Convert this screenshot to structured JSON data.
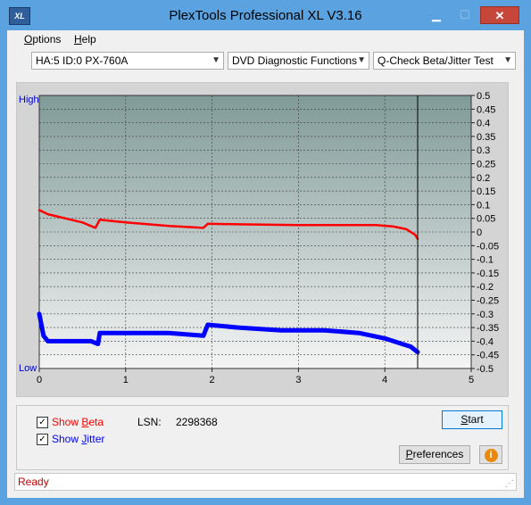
{
  "window": {
    "title": "PlexTools Professional XL V3.16",
    "icon_text": "XL"
  },
  "menu": {
    "items": [
      {
        "label": "Options",
        "ul": "O",
        "rest": "ptions"
      },
      {
        "label": "Help",
        "ul": "H",
        "rest": "elp"
      }
    ]
  },
  "toolbar": {
    "drive": "HA:5 ID:0  PX-760A",
    "function": "DVD Diagnostic Functions",
    "test": "Q-Check Beta/Jitter Test"
  },
  "chart_data": {
    "type": "line",
    "x_ticks": [
      "0",
      "1",
      "2",
      "3",
      "4",
      "5"
    ],
    "xlim": [
      0,
      5
    ],
    "y_ticks": [
      "0.5",
      "0.45",
      "0.4",
      "0.35",
      "0.3",
      "0.25",
      "0.2",
      "0.15",
      "0.1",
      "0.05",
      "0",
      "-0.05",
      "-0.1",
      "-0.15",
      "-0.2",
      "-0.25",
      "-0.3",
      "-0.35",
      "-0.4",
      "-0.45",
      "-0.5"
    ],
    "ylim": [
      -0.5,
      0.5
    ],
    "left_labels": {
      "high": "High",
      "low": "Low"
    },
    "grid": true,
    "marker_x": 4.38,
    "series": [
      {
        "color": "#ff0000",
        "x": [
          0,
          0.1,
          0.3,
          0.5,
          0.65,
          0.7,
          1.0,
          1.5,
          1.9,
          1.95,
          2.3,
          3.0,
          3.5,
          3.9,
          4.1,
          4.25,
          4.35,
          4.38
        ],
        "y": [
          0.08,
          0.065,
          0.05,
          0.035,
          0.015,
          0.045,
          0.035,
          0.022,
          0.015,
          0.03,
          0.028,
          0.025,
          0.025,
          0.025,
          0.02,
          0.01,
          -0.01,
          -0.025
        ]
      },
      {
        "color": "#0000ff",
        "x": [
          0,
          0.05,
          0.1,
          0.3,
          0.6,
          0.68,
          0.7,
          1.0,
          1.5,
          1.9,
          1.95,
          2.3,
          2.8,
          3.3,
          3.7,
          4.0,
          4.2,
          4.3,
          4.38
        ],
        "y": [
          -0.3,
          -0.38,
          -0.4,
          -0.4,
          -0.4,
          -0.41,
          -0.37,
          -0.37,
          -0.37,
          -0.38,
          -0.34,
          -0.35,
          -0.36,
          -0.36,
          -0.37,
          -0.39,
          -0.41,
          -0.42,
          -0.44
        ]
      }
    ]
  },
  "controls": {
    "show_beta": {
      "pre": "Show ",
      "ul": "B",
      "post": "eta",
      "checked": "✓"
    },
    "show_jitter": {
      "pre": "Show ",
      "ul": "J",
      "post": "itter",
      "checked": "✓"
    },
    "lsn_label": "LSN:",
    "lsn_value": "2298368",
    "start": {
      "ul": "S",
      "post": "tart"
    },
    "preferences": {
      "ul": "P",
      "post": "references"
    },
    "info_icon": "info-icon"
  },
  "status": {
    "text": "Ready"
  },
  "colors": {
    "status": "#cc0000",
    "beta": "#ff0000",
    "jitter": "#0000ff",
    "axis_label": "#0000cc",
    "plot_top": "#7f9a97",
    "plot_bottom": "#f5f5f5"
  }
}
